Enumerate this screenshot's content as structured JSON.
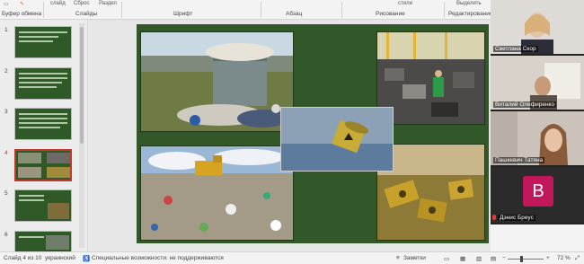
{
  "ribbon": {
    "groups": [
      {
        "label": "Буфер обмена"
      },
      {
        "label": "Слайды"
      },
      {
        "label": "Шрифт"
      },
      {
        "label": "Абзац"
      },
      {
        "label": "Рисование"
      },
      {
        "label": "Редактирование"
      }
    ],
    "top_items": [
      "слайд",
      "Сброс",
      "Раздел",
      "стили",
      "Выделить"
    ],
    "select_label": "Выделить"
  },
  "thumbnails": {
    "numbers": [
      "1",
      "2",
      "3",
      "4",
      "5",
      "6"
    ],
    "active_index": 4
  },
  "slide": {
    "background": "#32582a"
  },
  "video": {
    "participants": [
      {
        "name": "Светлана Скор"
      },
      {
        "name": "Виталий Олефиренко"
      },
      {
        "name": "Пашкевич Татяна"
      },
      {
        "name": "Дэнис Бреус",
        "initial": "B"
      }
    ]
  },
  "status": {
    "slide_info": "Слайд 4 из 10",
    "language": "украинский",
    "accessibility": "Специальные возможности: не поддерживаются",
    "notes": "Заметки",
    "zoom": "72 %"
  }
}
